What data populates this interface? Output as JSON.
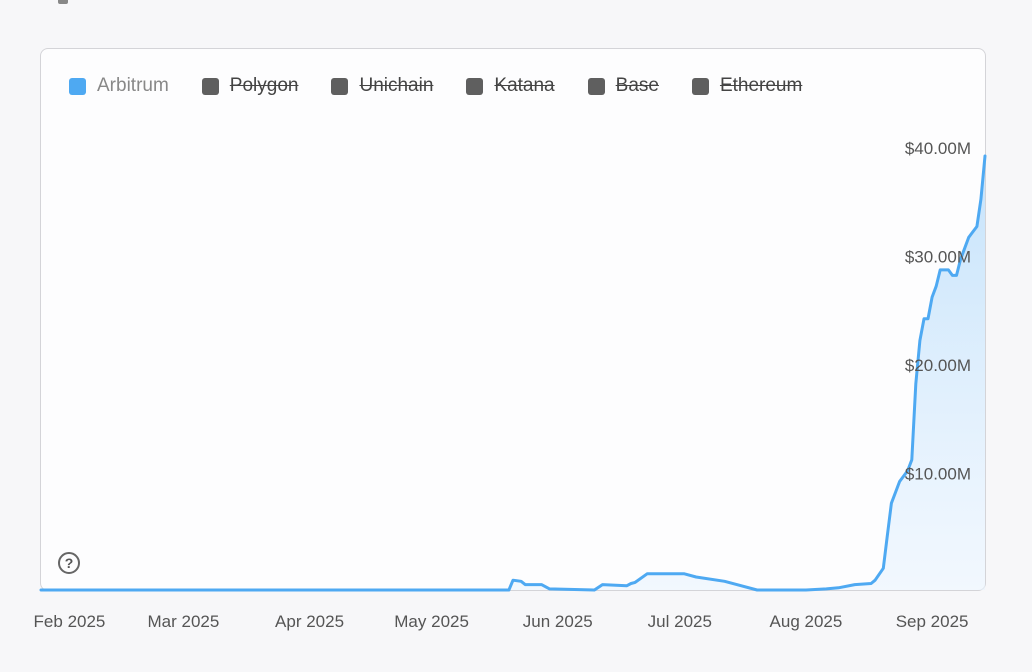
{
  "chart_data": {
    "type": "area",
    "title": "",
    "xlabel": "",
    "ylabel": "",
    "legend": {
      "placement": "top-left",
      "items": [
        {
          "name": "Arbitrum",
          "color": "#4ea9f2",
          "visible": true
        },
        {
          "name": "Polygon",
          "color": "#5f5f5f",
          "visible": false
        },
        {
          "name": "Unichain",
          "color": "#5f5f5f",
          "visible": false
        },
        {
          "name": "Katana",
          "color": "#5f5f5f",
          "visible": false
        },
        {
          "name": "Base",
          "color": "#5f5f5f",
          "visible": false
        },
        {
          "name": "Ethereum",
          "color": "#5f5f5f",
          "visible": false
        }
      ]
    },
    "y_ticks": [
      {
        "value": 10,
        "label": "$10.00M"
      },
      {
        "value": 20,
        "label": "$20.00M"
      },
      {
        "value": 30,
        "label": "$30.00M"
      },
      {
        "value": 40,
        "label": "$40.00M"
      }
    ],
    "x_ticks": [
      {
        "date": "2025-02-01",
        "label": "Feb 2025"
      },
      {
        "date": "2025-03-01",
        "label": "Mar 2025"
      },
      {
        "date": "2025-04-01",
        "label": "Apr 2025"
      },
      {
        "date": "2025-05-01",
        "label": "May 2025"
      },
      {
        "date": "2025-06-01",
        "label": "Jun 2025"
      },
      {
        "date": "2025-07-01",
        "label": "Jul 2025"
      },
      {
        "date": "2025-08-01",
        "label": "Aug 2025"
      },
      {
        "date": "2025-09-01",
        "label": "Sep 2025"
      }
    ],
    "xlim": [
      "2025-01-25",
      "2025-09-14"
    ],
    "ylim": [
      0,
      43
    ],
    "grid": false,
    "series": [
      {
        "name": "Arbitrum",
        "color": "#4ea9f2",
        "x": [
          "2025-01-25",
          "2025-05-01",
          "2025-05-20",
          "2025-05-21",
          "2025-05-23",
          "2025-05-24",
          "2025-05-28",
          "2025-05-30",
          "2025-06-10",
          "2025-06-12",
          "2025-06-18",
          "2025-06-19",
          "2025-06-20",
          "2025-06-23",
          "2025-07-02",
          "2025-07-05",
          "2025-07-12",
          "2025-07-15",
          "2025-07-20",
          "2025-08-01",
          "2025-08-06",
          "2025-08-09",
          "2025-08-13",
          "2025-08-17",
          "2025-08-18",
          "2025-08-20",
          "2025-08-21",
          "2025-08-22",
          "2025-08-23",
          "2025-08-24",
          "2025-08-25",
          "2025-08-26",
          "2025-08-27",
          "2025-08-28",
          "2025-08-29",
          "2025-08-30",
          "2025-08-31",
          "2025-09-01",
          "2025-09-02",
          "2025-09-03",
          "2025-09-05",
          "2025-09-06",
          "2025-09-07",
          "2025-09-08",
          "2025-09-09",
          "2025-09-10",
          "2025-09-11",
          "2025-09-12",
          "2025-09-13",
          "2025-09-14"
        ],
        "values": [
          0,
          0,
          0,
          0.9,
          0.8,
          0.5,
          0.5,
          0.1,
          0,
          0.5,
          0.4,
          0.6,
          0.7,
          1.5,
          1.5,
          1.2,
          0.8,
          0.5,
          0,
          0,
          0.1,
          0.2,
          0.5,
          0.6,
          0.9,
          2,
          5,
          8,
          9,
          10,
          10.5,
          11,
          12,
          19,
          23,
          25,
          25,
          27,
          28,
          29.5,
          29.5,
          29,
          29,
          30.5,
          31.5,
          32.5,
          33,
          33.5,
          36,
          40
        ]
      }
    ]
  }
}
